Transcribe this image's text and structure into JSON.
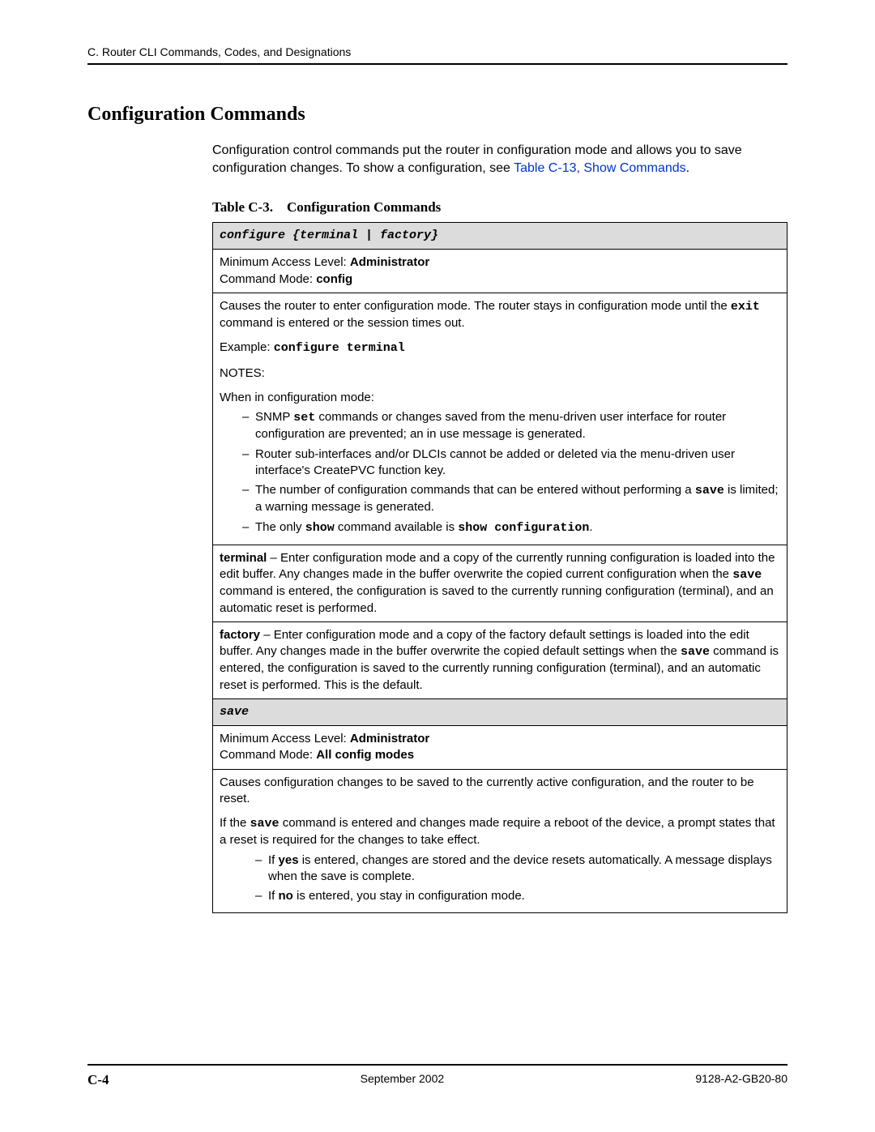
{
  "header": {
    "running_head": "C. Router CLI Commands, Codes, and Designations"
  },
  "section": {
    "title": "Configuration Commands",
    "intro_prefix": "Configuration control commands put the router in configuration mode and allows you to save configuration changes. To show a configuration, see ",
    "intro_link": "Table C-13, Show Commands",
    "intro_suffix": "."
  },
  "table": {
    "caption": "Table C-3. Configuration Commands",
    "row1_header": "configure {terminal | factory}",
    "row2_line1_prefix": "Minimum Access Level: ",
    "row2_line1_bold": "Administrator",
    "row2_line2_prefix": "Command Mode: ",
    "row2_line2_bold": "config",
    "row3_p1_a": "Causes the router to enter configuration mode. The router stays in configuration mode until the ",
    "row3_p1_code": "exit",
    "row3_p1_b": " command is entered or the session times out.",
    "row3_example_label": "Example: ",
    "row3_example_code": "configure terminal",
    "row3_notes": "NOTES:",
    "row3_when": "When in configuration mode:",
    "row3_li1_a": "SNMP ",
    "row3_li1_code": "set",
    "row3_li1_b": " commands or changes saved from the menu-driven user interface for router configuration are prevented; an in use message is generated.",
    "row3_li2": "Router sub-interfaces and/or DLCIs cannot be added or deleted via the menu-driven user interface's CreatePVC function key.",
    "row3_li3_a": "The number of configuration commands that can be entered without performing a ",
    "row3_li3_code": "save",
    "row3_li3_b": " is limited; a warning message is generated.",
    "row3_li4_a": "The only ",
    "row3_li4_code1": "show",
    "row3_li4_b": " command available is ",
    "row3_li4_code2": "show configuration",
    "row3_li4_c": ".",
    "row4_term_bold": "terminal",
    "row4_term_a": " – Enter configuration mode and a copy of the currently running configuration is loaded into the edit buffer. Any changes made in the buffer overwrite the copied current configuration when the ",
    "row4_term_code": "save",
    "row4_term_b": " command is entered, the configuration is saved to the currently running configuration (terminal), and an automatic reset is performed.",
    "row5_fact_bold": "factory",
    "row5_fact_a": " – Enter configuration mode and a copy of the factory default settings is loaded into the edit buffer. Any changes made in the buffer overwrite the copied default settings when the ",
    "row5_fact_code": "save",
    "row5_fact_b": " command is entered, the configuration is saved to the currently running configuration (terminal), and an automatic reset is performed. This is the default.",
    "row6_header": "save",
    "row7_line1_prefix": "Minimum Access Level: ",
    "row7_line1_bold": "Administrator",
    "row7_line2_prefix": "Command Mode: ",
    "row7_line2_bold": "All config modes",
    "row8_p1": "Causes configuration changes to be saved to the currently active configuration, and the router to be reset.",
    "row8_p2_a": "If the ",
    "row8_p2_code": "save",
    "row8_p2_b": " command is entered and changes made require a reboot of the device, a prompt states that a reset is required for the changes to take effect.",
    "row8_li1_a": "If ",
    "row8_li1_bold": "yes",
    "row8_li1_b": " is entered, changes are stored and the device resets automatically. A message displays when the save is complete.",
    "row8_li2_a": "If ",
    "row8_li2_bold": "no",
    "row8_li2_b": " is entered, you stay in configuration mode."
  },
  "footer": {
    "page": "C-4",
    "date": "September 2002",
    "docnum": "9128-A2-GB20-80"
  }
}
